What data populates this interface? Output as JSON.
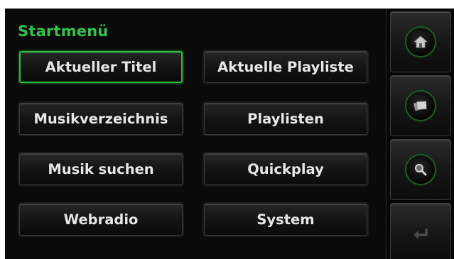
{
  "title": "Startmenü",
  "menu": [
    {
      "label": "Aktueller Titel",
      "active": true
    },
    {
      "label": "Aktuelle Playliste",
      "active": false
    },
    {
      "label": "Musikverzeichnis",
      "active": false
    },
    {
      "label": "Playlisten",
      "active": false
    },
    {
      "label": "Musik suchen",
      "active": false
    },
    {
      "label": "Quickplay",
      "active": false
    },
    {
      "label": "Webradio",
      "active": false
    },
    {
      "label": "System",
      "active": false
    }
  ],
  "side_icons": [
    "home-icon",
    "albums-icon",
    "search-icon",
    "back-return-icon"
  ],
  "colors": {
    "accent": "#33c24a",
    "background": "#0a0a0a",
    "button_text": "#e6e6e6"
  }
}
